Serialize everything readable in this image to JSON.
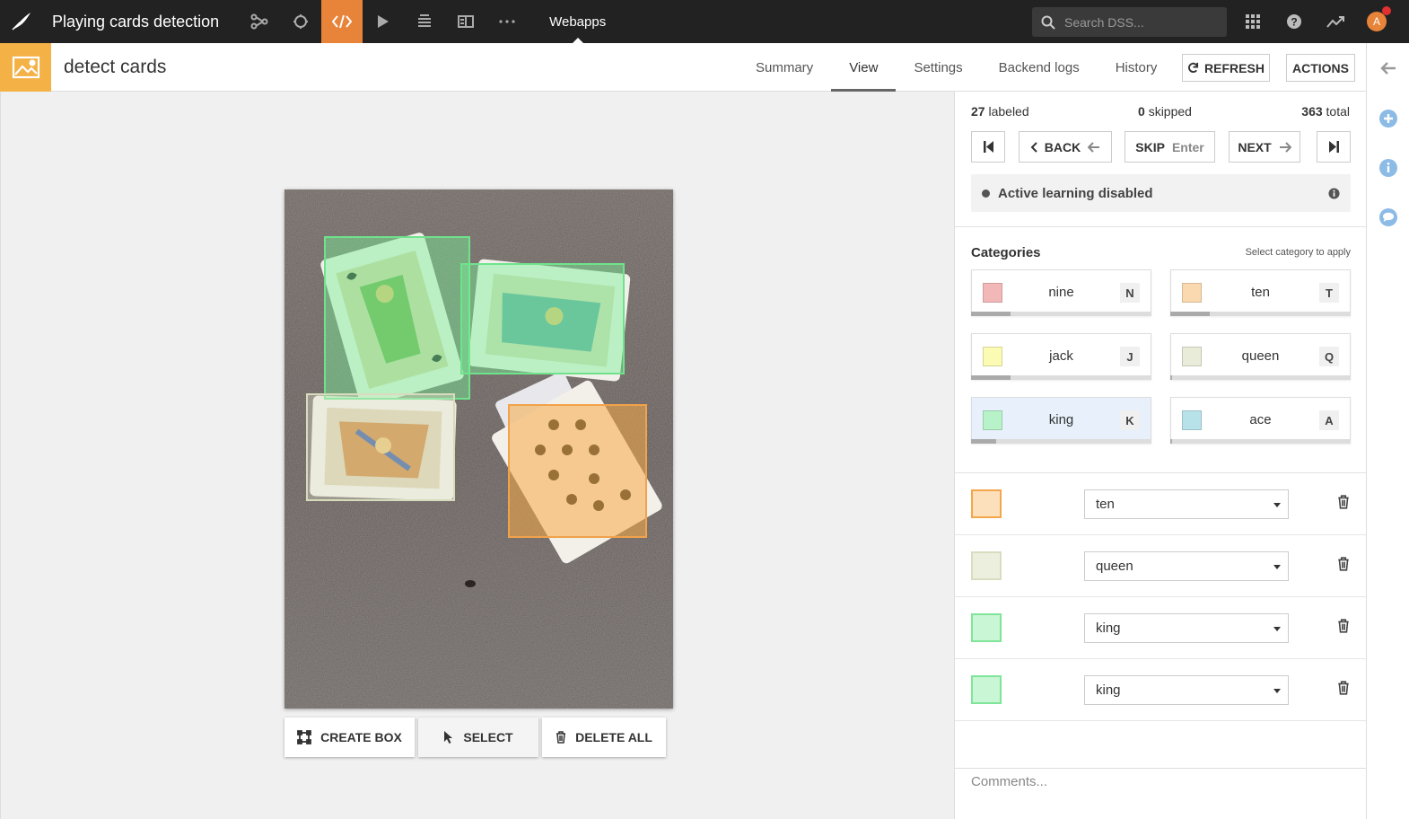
{
  "topbar": {
    "project_title": "Playing cards detection",
    "section_label": "Webapps",
    "search_placeholder": "Search DSS...",
    "avatar_initial": "A",
    "icons": [
      "flow-icon",
      "recycle-icon",
      "code-icon",
      "play-icon",
      "database-icon",
      "dashboard-icon",
      "more-icon"
    ]
  },
  "header": {
    "title": "detect cards",
    "tabs": [
      "Summary",
      "View",
      "Settings",
      "Backend logs",
      "History"
    ],
    "active_tab": "View",
    "refresh_label": "REFRESH",
    "actions_label": "ACTIONS"
  },
  "stats": {
    "labeled_count": "27",
    "labeled_label": "labeled",
    "skipped_count": "0",
    "skipped_label": "skipped",
    "total_count": "363",
    "total_label": "total"
  },
  "navigation": {
    "back_label": "BACK",
    "skip_label": "SKIP",
    "skip_key": "Enter",
    "next_label": "NEXT"
  },
  "active_learning": {
    "text": "Active learning disabled"
  },
  "categories": {
    "title": "Categories",
    "hint": "Select category to apply",
    "items": [
      {
        "name": "nine",
        "key": "N",
        "color": "#f2b8b8",
        "progress": 0.22
      },
      {
        "name": "ten",
        "key": "T",
        "color": "#fbd9b0",
        "progress": 0.22
      },
      {
        "name": "jack",
        "key": "J",
        "color": "#fbfbb4",
        "progress": 0.22
      },
      {
        "name": "queen",
        "key": "Q",
        "color": "#e9ecd8",
        "progress": 0.01
      },
      {
        "name": "king",
        "key": "K",
        "color": "#b7f2c8",
        "progress": 0.14,
        "selected": true
      },
      {
        "name": "ace",
        "key": "A",
        "color": "#b8e2ea",
        "progress": 0.01
      }
    ]
  },
  "annotations": [
    {
      "category": "ten",
      "color": "#f4a64c",
      "fill": "#fbe0bb"
    },
    {
      "category": "queen",
      "color": "#d9ddc0",
      "fill": "#ecefde"
    },
    {
      "category": "king",
      "color": "#7fe59a",
      "fill": "#c9f6d4"
    },
    {
      "category": "king",
      "color": "#7fe59a",
      "fill": "#c9f6d4"
    }
  ],
  "toolbar": {
    "create_box_label": "CREATE BOX",
    "select_label": "SELECT",
    "delete_all_label": "DELETE ALL"
  },
  "comments": {
    "placeholder": "Comments..."
  }
}
